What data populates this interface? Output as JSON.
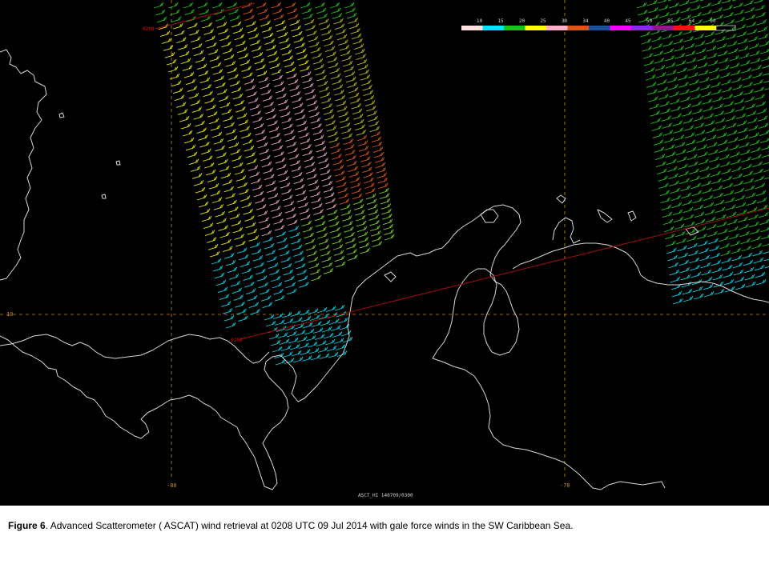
{
  "legend": {
    "bins": [
      {
        "label": "10",
        "color": "#ffe0e0"
      },
      {
        "label": "15",
        "color": "#00e5ff"
      },
      {
        "label": "20",
        "color": "#1fbf1f"
      },
      {
        "label": "25",
        "color": "#ffff00"
      },
      {
        "label": "30",
        "color": "#ffb0c8"
      },
      {
        "label": "34",
        "color": "#d9541a"
      },
      {
        "label": "40",
        "color": "#1d4f9a"
      },
      {
        "label": "45",
        "color": "#ff00ff"
      },
      {
        "label": "50",
        "color": "#8a2be2"
      },
      {
        "label": "55",
        "color": "#8b1a8b"
      },
      {
        "label": "64",
        "color": "#ff1010"
      },
      {
        "label": "80",
        "color": "#ffff00"
      }
    ]
  },
  "graticule": {
    "lat_label": "10",
    "lon_labels": [
      "-80",
      "-70"
    ]
  },
  "pass_times": [
    "0208",
    "0208"
  ],
  "product_label": "ASCT_HI 140709/0300",
  "caption": {
    "figure": "Figure 6",
    "text": ". Advanced Scatterometer ( ASCAT) wind retrieval at 0208 UTC 09 Jul  2014 with gale force winds in the SW Caribbean Sea."
  },
  "colors": {
    "background": "#000000",
    "coastline": "#d8d8d8",
    "graticule": "#c98a2a",
    "track": "#a01010"
  }
}
